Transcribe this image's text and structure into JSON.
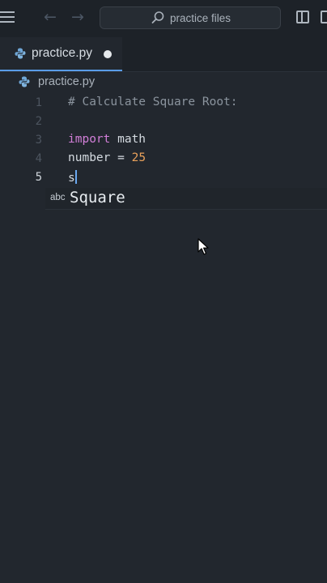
{
  "titlebar": {
    "search_text": "practice files",
    "icons": [
      "menu-icon",
      "arrow-left-icon",
      "arrow-right-icon",
      "search-icon",
      "sidebar-layout-icon",
      "panel-layout-icon"
    ]
  },
  "tab": {
    "label": "practice.py",
    "modified": true,
    "icon": "python-icon"
  },
  "breadcrumb": {
    "label": "practice.py"
  },
  "editor": {
    "lines": [
      {
        "number": "1",
        "text": "# Calculate Square Root:"
      },
      {
        "number": "2",
        "text": ""
      },
      {
        "number": "3",
        "keyword": "import",
        "rest": " math"
      },
      {
        "number": "4",
        "ident": "number",
        "op": " = ",
        "value": "25"
      },
      {
        "number": "5",
        "text": "s"
      }
    ],
    "current_line": 5
  },
  "suggestion": {
    "kind": "abc",
    "label": "Square"
  },
  "colors": {
    "background": "#22272e",
    "keyword": "#d27fd8",
    "number": "#e9a15b",
    "accent": "#5a9ce8"
  }
}
